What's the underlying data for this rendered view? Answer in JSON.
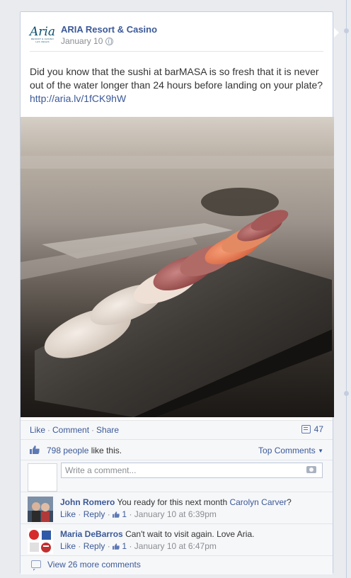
{
  "post": {
    "page_name": "ARIA Resort & Casino",
    "logo": {
      "word": "Aria",
      "subtitle": "Resort & Casino Las Vegas"
    },
    "date": "January 10",
    "audience_icon": "globe-icon",
    "text": "Did you know that the sushi at barMASA is so fresh that it is never out of the water longer than 24 hours before landing on your plate?",
    "link": "http://aria.lv/1fCK9hW",
    "photo_description": "sushi"
  },
  "actions": {
    "like": "Like",
    "comment": "Comment",
    "share": "Share",
    "share_count": "47"
  },
  "likes": {
    "count_link": "798 people",
    "suffix": " like this.",
    "sort_label": "Top Comments"
  },
  "comment_input": {
    "placeholder": "Write a comment..."
  },
  "comments": [
    {
      "author": "John Romero",
      "text": "You ready for this next month",
      "mention": "Carolyn Carver",
      "mention_suffix": "?",
      "like": "Like",
      "reply": "Reply",
      "likes": "1",
      "time": "January 10 at 6:39pm"
    },
    {
      "author": "Maria DeBarros",
      "text": "Can't wait to visit again. Love Aria.",
      "like": "Like",
      "reply": "Reply",
      "likes": "1",
      "time": "January 10 at 6:47pm"
    }
  ],
  "view_more": "View 26 more comments",
  "colors": {
    "link": "#3b5998",
    "background": "#e9ebee",
    "card": "#ffffff",
    "footer": "#f6f7f9"
  }
}
